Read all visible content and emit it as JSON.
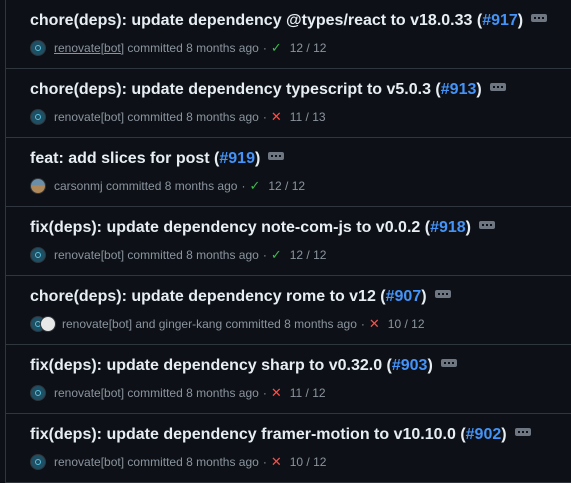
{
  "commits": [
    {
      "title": "chore(deps): update dependency @types/react to v18.0.33 (",
      "pr": "#917",
      "close": ")",
      "author": "renovate[bot]",
      "verb": "committed",
      "time": "8 months ago",
      "status": "pass",
      "checks": "12 / 12"
    },
    {
      "title": "chore(deps): update dependency typescript to v5.0.3 (",
      "pr": "#913",
      "close": ")",
      "author": "renovate[bot]",
      "verb": "committed",
      "time": "8 months ago",
      "status": "fail",
      "checks": "11 / 13"
    },
    {
      "title": "feat: add slices for post (",
      "pr": "#919",
      "close": ")",
      "author": "carsonmj",
      "verb": "committed",
      "time": "8 months ago",
      "status": "pass",
      "checks": "12 / 12"
    },
    {
      "title": "fix(deps): update dependency note-com-js to v0.0.2 (",
      "pr": "#918",
      "close": ")",
      "author": "renovate[bot]",
      "verb": "committed",
      "time": "8 months ago",
      "status": "pass",
      "checks": "12 / 12"
    },
    {
      "title": "chore(deps): update dependency rome to v12 (",
      "pr": "#907",
      "close": ")",
      "author": "renovate[bot] and ginger-kang",
      "verb": "committed",
      "time": "8 months ago",
      "status": "fail",
      "checks": "10 / 12"
    },
    {
      "title": "fix(deps): update dependency sharp to v0.32.0 (",
      "pr": "#903",
      "close": ")",
      "author": "renovate[bot]",
      "verb": "committed",
      "time": "8 months ago",
      "status": "fail",
      "checks": "11 / 12"
    },
    {
      "title": "fix(deps): update dependency framer-motion to v10.10.0 (",
      "pr": "#902",
      "close": ")",
      "author": "renovate[bot]",
      "verb": "committed",
      "time": "8 months ago",
      "status": "fail",
      "checks": "10 / 12"
    }
  ],
  "symbols": {
    "dot": "·",
    "check": "✓",
    "cross": "✕"
  },
  "colors": {
    "background": "#0d1117",
    "link": "#4493f8",
    "pass": "#3fb950",
    "fail": "#f85149",
    "muted": "#8b949e"
  }
}
